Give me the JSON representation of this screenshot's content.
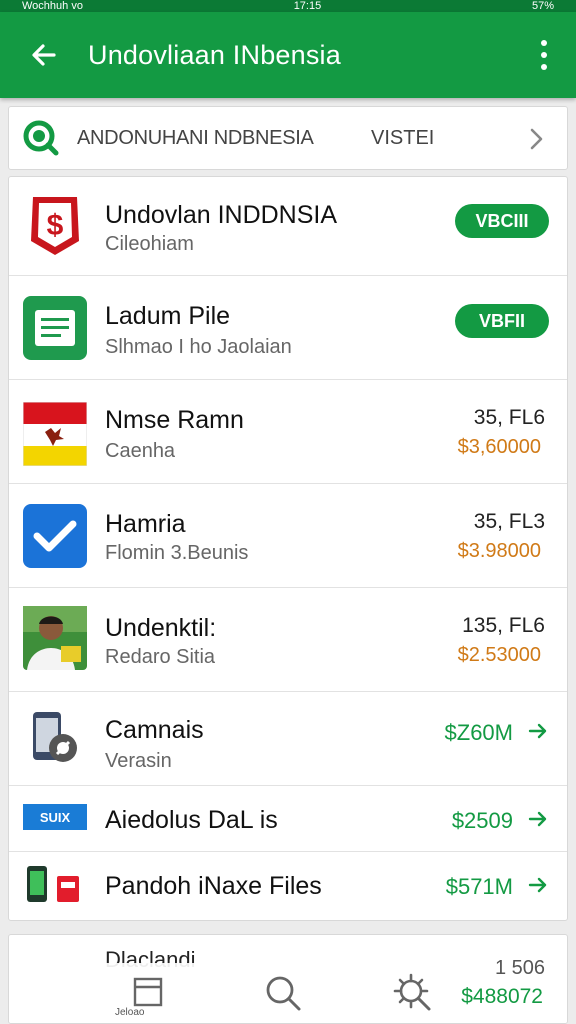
{
  "status_bar": {
    "left": "Wochhuh vo",
    "center": "17:15",
    "right": "57%"
  },
  "app_bar": {
    "title": "Undovliaan INbensia"
  },
  "search": {
    "text": "ANDONUHANI NDBNESIA",
    "action": "VISTEI"
  },
  "items": [
    {
      "title": "Undovlan INDDNSIA",
      "subtitle": "Cileohiam",
      "button": "VBCIII"
    },
    {
      "title": "Ladum Pile",
      "subtitle": "Slhmao I ho Jaolaian",
      "button": "VBFII"
    },
    {
      "title": "Nmse Ramn",
      "subtitle": "Caenha",
      "value_top": "35, FL6",
      "value_bottom": "$3,60000"
    },
    {
      "title": "Hamria",
      "subtitle": "Flomin 3.Beunis",
      "value_top": "35, FL3",
      "value_bottom": "$3.98000"
    },
    {
      "title": "Undenktil:",
      "subtitle": "Redaro Sitia",
      "value_top": "135, FL6",
      "value_bottom": "$2.53000"
    },
    {
      "title": "Camnais",
      "subtitle": "Verasin",
      "value": "$Z60M"
    },
    {
      "title": "Aiedolus DaL is",
      "value": "$2509"
    },
    {
      "title": "Pandoh iNaxe Files",
      "value": "$571M"
    }
  ],
  "bottom_peek": {
    "title": "Dlaclandi",
    "value_top": "1 506",
    "value_bottom": "$488072"
  },
  "bottom_nav": {
    "label": "Jeloao"
  },
  "colors": {
    "primary_green": "#139a43",
    "amount_orange": "#d07a17"
  },
  "icons": {
    "back": "arrow-left",
    "search": "search-circle",
    "chevron": "chevron-right"
  }
}
